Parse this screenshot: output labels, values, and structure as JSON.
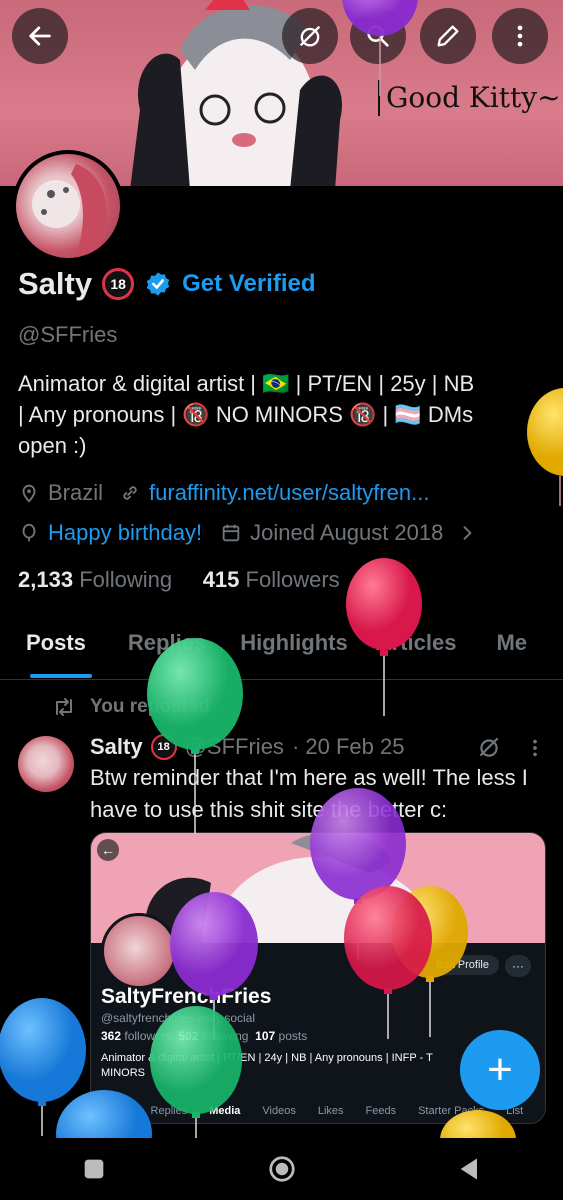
{
  "banner": {
    "sign_text": "Good Kitty~"
  },
  "header_buttons": {
    "back": "back",
    "mute": "mute",
    "search": "search",
    "edit": "edit",
    "more": "more"
  },
  "profile": {
    "name": "Salty",
    "age_badge": "18",
    "get_verified": "Get Verified",
    "handle": "@SFFries",
    "bio_line1": "Animator & digital artist | 🇧🇷 | PT/EN | 25y | NB",
    "bio_line2": "| Any pronouns  | 🔞 NO MINORS 🔞 | 🏳️‍⚧️  DMs",
    "bio_line3": "open :)",
    "location": "Brazil",
    "website": "furaffinity.net/user/saltyfren...",
    "birthday": "Happy birthday!",
    "joined": "Joined August 2018",
    "following_count": "2,133",
    "following_label": "Following",
    "followers_count": "415",
    "followers_label": "Followers"
  },
  "tabs": [
    "Posts",
    "Replies",
    "Highlights",
    "Articles",
    "Me"
  ],
  "post": {
    "repost_label": "You reposted",
    "author_name": "Salty",
    "author_badge": "18",
    "author_handle": "@SFFries",
    "date": "· 20 Feb 25",
    "text": "Btw reminder that I'm here as well! The less I have to use this shit site the better c:",
    "card": {
      "name": "SaltyFrenchFries",
      "handle": "@saltyfrenchfries.bsky.social",
      "followers": "362",
      "followers_label": "followers",
      "following": "502",
      "following_label": "following",
      "posts": "107",
      "posts_label": "posts",
      "bio": "Animator & digital artist | PT/EN | 24y | NB | Any pronouns | INFP - T",
      "bio2": "MINORS",
      "edit_profile": "Edit Profile",
      "more": "···",
      "tabs": [
        "Posts",
        "Replies",
        "Media",
        "Videos",
        "Likes",
        "Feeds",
        "Starter Packs",
        "List"
      ]
    }
  },
  "fab": "+",
  "colors": {
    "accent": "#1d9bf0",
    "background": "#000000",
    "banner": "#d97b8a"
  }
}
